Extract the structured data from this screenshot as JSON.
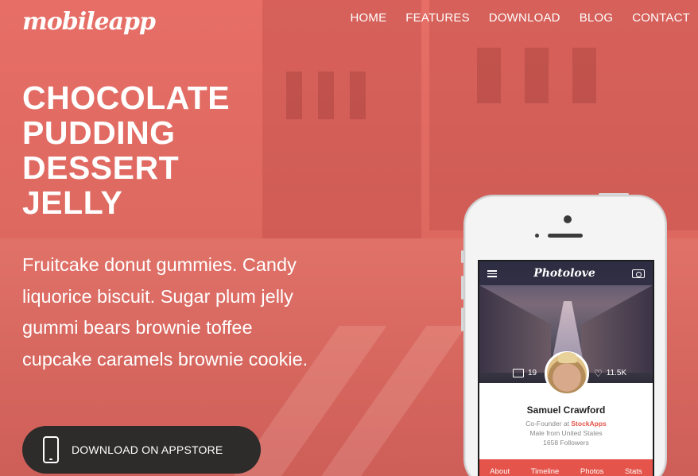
{
  "brand": {
    "logo": "mobileapp"
  },
  "nav": {
    "items": [
      "HOME",
      "FEATURES",
      "DOWNLOAD",
      "BLOG",
      "CONTACT"
    ]
  },
  "hero": {
    "headline": [
      "CHOCOLATE",
      "PUDDING",
      "DESSERT",
      "JELLY"
    ],
    "subtext": "Fruitcake donut gummies. Candy liquorice biscuit. Sugar plum jelly gummi bears brownie toffee cupcake caramels brownie cookie.",
    "cta_label": "DOWNLOAD ON APPSTORE",
    "cta_icon": "smartphone-icon"
  },
  "phone": {
    "app_title": "Photolove",
    "photos_count": "19",
    "likes_count": "11.5K",
    "profile": {
      "name": "Samuel Crawford",
      "role_prefix": "Co-Founder at",
      "company": "StockApps",
      "location": "Male from United States",
      "followers": "1658 Followers"
    },
    "tabs": [
      "About",
      "Timeline",
      "Photos",
      "Stats"
    ],
    "colors": {
      "accent": "#e4544a"
    }
  },
  "colors": {
    "hero_overlay": "#e2675f",
    "cta_bg": "#2e2b2b"
  }
}
